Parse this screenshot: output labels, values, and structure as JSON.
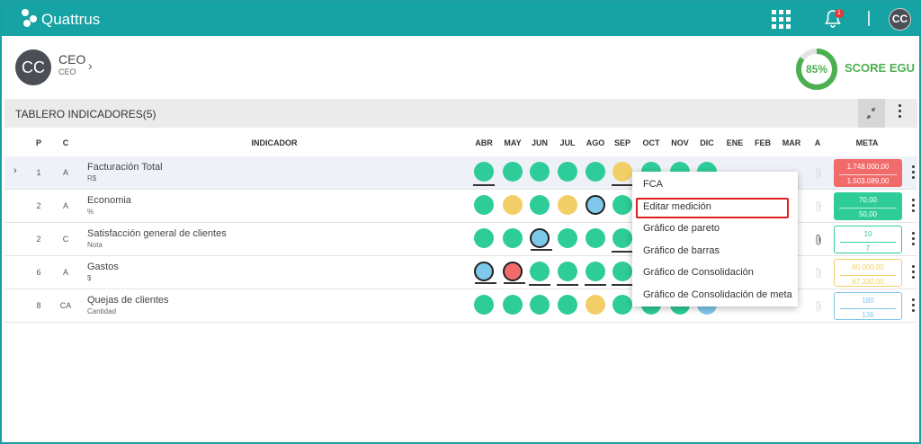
{
  "app": {
    "brand": "Quattrus",
    "notification_count": "1",
    "user_initials": "CC"
  },
  "profile": {
    "initials": "CC",
    "name": "CEO",
    "role": "CEO"
  },
  "score": {
    "percent": "85%",
    "value": 85,
    "label": "SCORE EGU"
  },
  "board": {
    "title": "TABLERO INDICADORES(5)"
  },
  "columns": {
    "p": "P",
    "c": "C",
    "indicator": "INDICADOR",
    "months": [
      "ABR",
      "MAY",
      "JUN",
      "JUL",
      "AGO",
      "SEP",
      "OCT",
      "NOV",
      "DIC",
      "ENE",
      "FEB",
      "MAR"
    ],
    "a": "A",
    "meta": "META"
  },
  "colors": {
    "accent": "#17a2a3",
    "green": "#2ecc98",
    "yellow": "#f2cf66",
    "blue": "#7ec8ea",
    "red": "#f26b6b",
    "score": "#4caf50"
  },
  "rows": [
    {
      "p": "1",
      "c": "A",
      "name": "Facturación Total",
      "unit": "R$",
      "months": [
        "green",
        "green",
        "green",
        "green",
        "green",
        "yellow",
        "green",
        "green",
        "green",
        "",
        "",
        ""
      ],
      "underline": [
        true,
        false,
        false,
        false,
        false,
        true,
        false,
        false,
        false,
        false,
        false,
        false
      ],
      "outlined": [
        false,
        false,
        false,
        false,
        false,
        false,
        false,
        false,
        false,
        false,
        false,
        false
      ],
      "meta_top": "1.748.000,00",
      "meta_bottom": "1.503.089,00",
      "meta_style": "filled",
      "meta_color": "#f26b6b"
    },
    {
      "p": "2",
      "c": "A",
      "name": "Economia",
      "unit": "%",
      "months": [
        "green",
        "yellow",
        "green",
        "yellow",
        "blue",
        "green",
        "",
        "",
        "",
        "",
        "",
        ""
      ],
      "underline": [
        false,
        false,
        false,
        false,
        false,
        false,
        false,
        false,
        false,
        false,
        false,
        false
      ],
      "outlined": [
        false,
        false,
        false,
        false,
        true,
        false,
        false,
        false,
        false,
        false,
        false,
        false
      ],
      "meta_top": "70,00",
      "meta_bottom": "50,00",
      "meta_style": "filled",
      "meta_color": "#2ecc98"
    },
    {
      "p": "2",
      "c": "C",
      "name": "Satisfacción general de clientes",
      "unit": "Nota",
      "months": [
        "green",
        "green",
        "blue",
        "green",
        "green",
        "green",
        "",
        "",
        "",
        "",
        "",
        ""
      ],
      "underline": [
        false,
        false,
        true,
        false,
        false,
        true,
        false,
        false,
        false,
        false,
        false,
        false
      ],
      "outlined": [
        false,
        false,
        true,
        false,
        false,
        false,
        false,
        false,
        false,
        false,
        false,
        false
      ],
      "meta_top": "10",
      "meta_bottom": "7",
      "meta_style": "outline",
      "meta_color": "#2ecc98"
    },
    {
      "p": "6",
      "c": "A",
      "name": "Gastos",
      "unit": "$",
      "months": [
        "blue",
        "red",
        "green",
        "green",
        "green",
        "green",
        "",
        "",
        "",
        "",
        "",
        ""
      ],
      "underline": [
        true,
        true,
        true,
        true,
        true,
        true,
        false,
        false,
        false,
        false,
        false,
        false
      ],
      "outlined": [
        true,
        true,
        false,
        false,
        false,
        false,
        false,
        false,
        false,
        false,
        false,
        false
      ],
      "meta_top": "60.000,00",
      "meta_bottom": "67.330,00",
      "meta_style": "outline",
      "meta_color": "#f2cf66"
    },
    {
      "p": "8",
      "c": "CA",
      "name": "Quejas de clientes",
      "unit": "Cantidad",
      "months": [
        "green",
        "green",
        "green",
        "green",
        "yellow",
        "green",
        "green",
        "green",
        "blue",
        "",
        "",
        ""
      ],
      "underline": [
        false,
        false,
        false,
        false,
        false,
        false,
        false,
        false,
        false,
        false,
        false,
        false
      ],
      "outlined": [
        false,
        false,
        false,
        false,
        false,
        false,
        false,
        false,
        false,
        false,
        false,
        false
      ],
      "meta_top": "180",
      "meta_bottom": "136",
      "meta_style": "outline",
      "meta_color": "#7ec8ea"
    }
  ],
  "context_menu": {
    "items": [
      "FCA",
      "Editar medición",
      "Gráfico de pareto",
      "Gráfico de barras",
      "Gráfico de Consolidación",
      "Gráfico de Consolidación de meta"
    ],
    "highlighted_index": 1
  }
}
